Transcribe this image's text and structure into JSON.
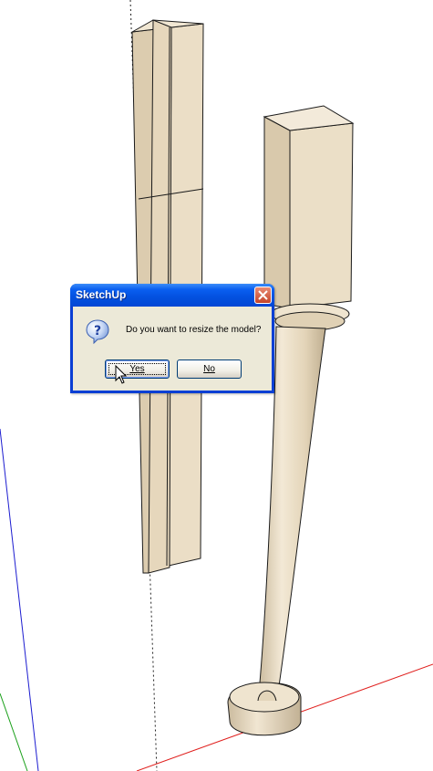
{
  "dialog": {
    "title": "SketchUp",
    "message": "Do you want to resize the model?",
    "yes_label": "Yes",
    "no_label": "No",
    "icon": "question-icon",
    "close_icon": "close-icon"
  },
  "colors": {
    "model_face": "#e9dcc4",
    "model_edge": "#1a1a1a",
    "axis_red": "#e0201e",
    "axis_green": "#1aa01a",
    "axis_blue": "#1c1cd0",
    "title_bar": "#0350df",
    "dialog_body": "#ece9d8"
  }
}
